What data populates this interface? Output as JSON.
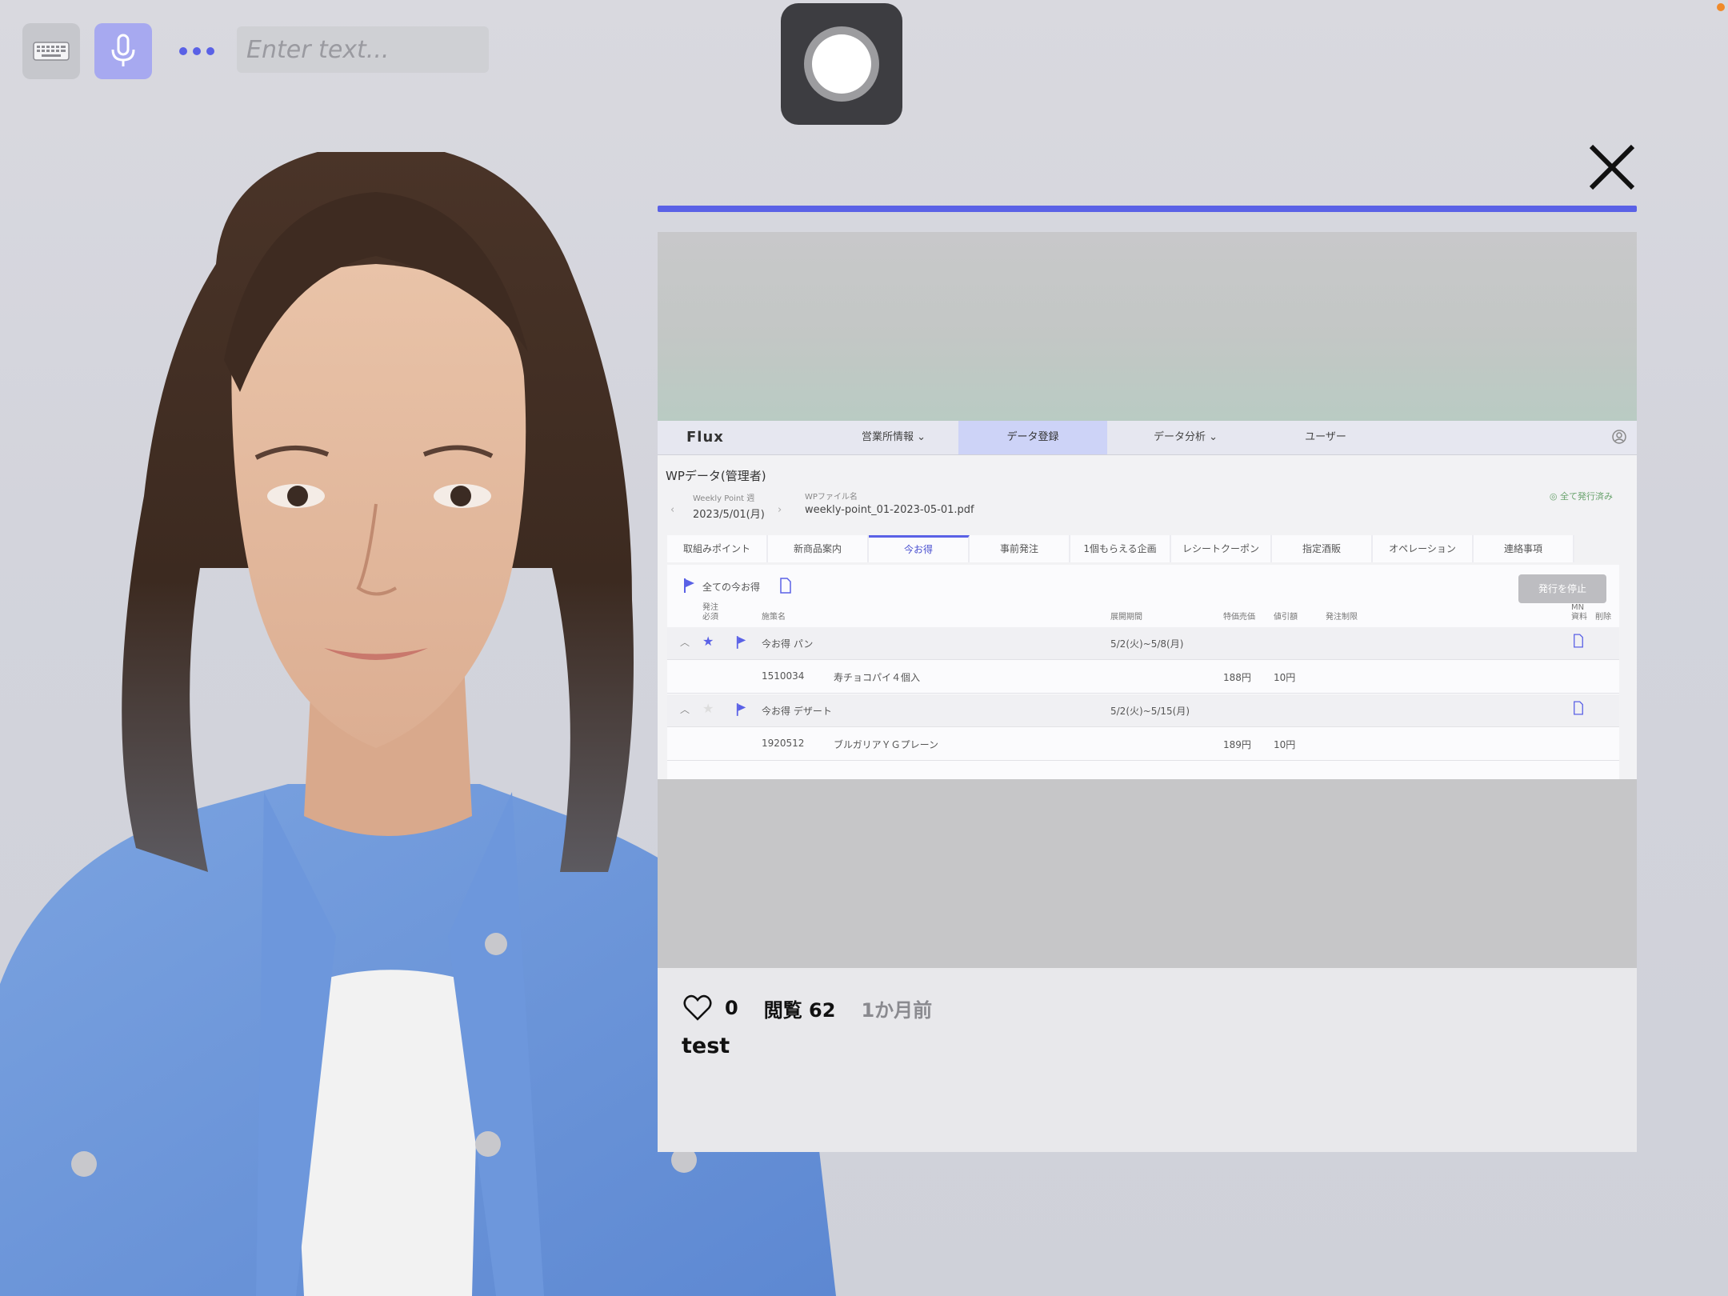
{
  "toolbar": {
    "input_placeholder": "Enter text...",
    "keyboard_icon": "keyboard-icon",
    "mic_icon": "microphone-icon",
    "more_icon": "more-dots-icon",
    "record_icon": "record-icon"
  },
  "colors": {
    "accent": "#5a61e6",
    "mic_bg": "#a7a9f0",
    "record_bg": "#3d3d41"
  },
  "screenshot": {
    "logo": "Flux",
    "nav": [
      "営業所情報",
      "データ登録",
      "データ分析",
      "ユーザー"
    ],
    "page_title": "WPデータ(管理者)",
    "week_label": "Weekly Point 週",
    "week_value": "2023/5/01(月)",
    "file_label": "WPファイル名",
    "file_value": "weekly-point_01-2023-05-01.pdf",
    "done_status": "全て発行済み",
    "tabs": [
      "取組みポイント",
      "新商品案内",
      "今お得",
      "事前発注",
      "1個もらえる企画",
      "レシートクーポン",
      "指定酒販",
      "オペレーション",
      "連絡事項"
    ],
    "active_tab": "今お得",
    "panel_title": "全ての今お得",
    "stop_button": "発行を停止",
    "columns": {
      "order_required": "発注\n必須",
      "product_name": "施策名",
      "period": "展開期間",
      "price": "特価売価",
      "discount": "値引額",
      "order_limit": "発注制限",
      "mn": "MN\n資料",
      "delete": "削除"
    },
    "groups": [
      {
        "name": "今お得 パン",
        "period": "5/2(火)~5/8(月)",
        "item_code": "1510034",
        "item_name": "寿チョコパイ４個入",
        "price": "188円",
        "discount": "10円"
      },
      {
        "name": "今お得 デザート",
        "period": "5/2(火)~5/15(月)",
        "item_code": "1920512",
        "item_name": "ブルガリアＹＧプレーン",
        "price": "189円",
        "discount": "10円"
      }
    ]
  },
  "footer": {
    "heart_icon": "heart-icon",
    "likes": "0",
    "views": "閲覧 62",
    "time_ago": "1か月前",
    "post_text": "test"
  }
}
